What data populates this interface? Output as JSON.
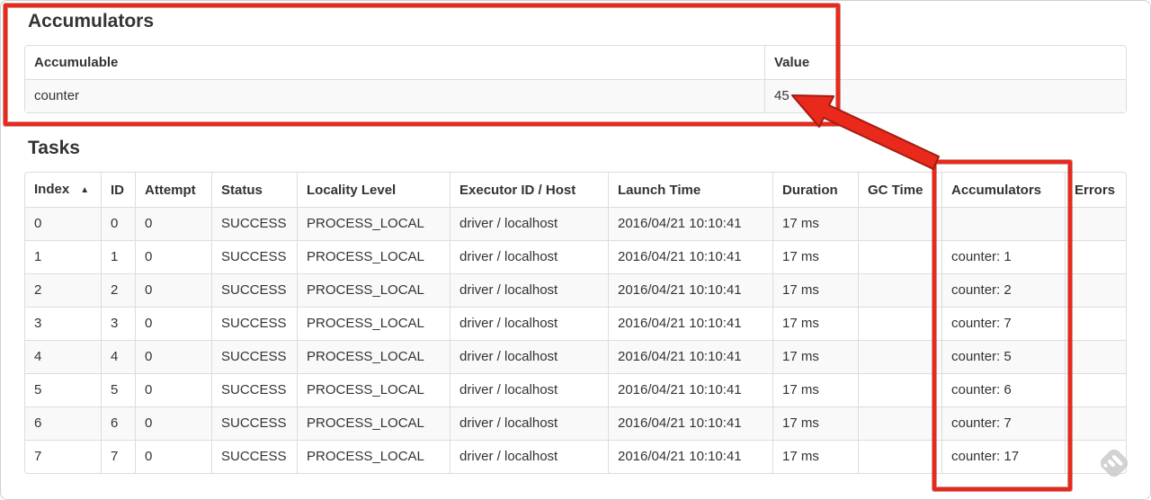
{
  "annotations": {
    "color": "#e8291c"
  },
  "accumulators_section": {
    "title": "Accumulators",
    "table": {
      "headers": [
        "Accumulable",
        "Value"
      ],
      "rows": [
        {
          "accumulable": "counter",
          "value": "45"
        }
      ]
    }
  },
  "tasks_section": {
    "title": "Tasks",
    "table": {
      "sort_icon": "▲",
      "headers": [
        "Index",
        "ID",
        "Attempt",
        "Status",
        "Locality Level",
        "Executor ID / Host",
        "Launch Time",
        "Duration",
        "GC Time",
        "Accumulators",
        "Errors"
      ],
      "rows": [
        {
          "index": "0",
          "id": "0",
          "attempt": "0",
          "status": "SUCCESS",
          "locality_level": "PROCESS_LOCAL",
          "executor_id_host": "driver / localhost",
          "launch_time": "2016/04/21 10:10:41",
          "duration": "17 ms",
          "gc_time": "",
          "accumulators": "",
          "errors": ""
        },
        {
          "index": "1",
          "id": "1",
          "attempt": "0",
          "status": "SUCCESS",
          "locality_level": "PROCESS_LOCAL",
          "executor_id_host": "driver / localhost",
          "launch_time": "2016/04/21 10:10:41",
          "duration": "17 ms",
          "gc_time": "",
          "accumulators": "counter: 1",
          "errors": ""
        },
        {
          "index": "2",
          "id": "2",
          "attempt": "0",
          "status": "SUCCESS",
          "locality_level": "PROCESS_LOCAL",
          "executor_id_host": "driver / localhost",
          "launch_time": "2016/04/21 10:10:41",
          "duration": "17 ms",
          "gc_time": "",
          "accumulators": "counter: 2",
          "errors": ""
        },
        {
          "index": "3",
          "id": "3",
          "attempt": "0",
          "status": "SUCCESS",
          "locality_level": "PROCESS_LOCAL",
          "executor_id_host": "driver / localhost",
          "launch_time": "2016/04/21 10:10:41",
          "duration": "17 ms",
          "gc_time": "",
          "accumulators": "counter: 7",
          "errors": ""
        },
        {
          "index": "4",
          "id": "4",
          "attempt": "0",
          "status": "SUCCESS",
          "locality_level": "PROCESS_LOCAL",
          "executor_id_host": "driver / localhost",
          "launch_time": "2016/04/21 10:10:41",
          "duration": "17 ms",
          "gc_time": "",
          "accumulators": "counter: 5",
          "errors": ""
        },
        {
          "index": "5",
          "id": "5",
          "attempt": "0",
          "status": "SUCCESS",
          "locality_level": "PROCESS_LOCAL",
          "executor_id_host": "driver / localhost",
          "launch_time": "2016/04/21 10:10:41",
          "duration": "17 ms",
          "gc_time": "",
          "accumulators": "counter: 6",
          "errors": ""
        },
        {
          "index": "6",
          "id": "6",
          "attempt": "0",
          "status": "SUCCESS",
          "locality_level": "PROCESS_LOCAL",
          "executor_id_host": "driver / localhost",
          "launch_time": "2016/04/21 10:10:41",
          "duration": "17 ms",
          "gc_time": "",
          "accumulators": "counter: 7",
          "errors": ""
        },
        {
          "index": "7",
          "id": "7",
          "attempt": "0",
          "status": "SUCCESS",
          "locality_level": "PROCESS_LOCAL",
          "executor_id_host": "driver / localhost",
          "launch_time": "2016/04/21 10:10:41",
          "duration": "17 ms",
          "gc_time": "",
          "accumulators": "counter: 17",
          "errors": ""
        }
      ]
    }
  },
  "watermark": {
    "icon": "feedly-logo"
  }
}
